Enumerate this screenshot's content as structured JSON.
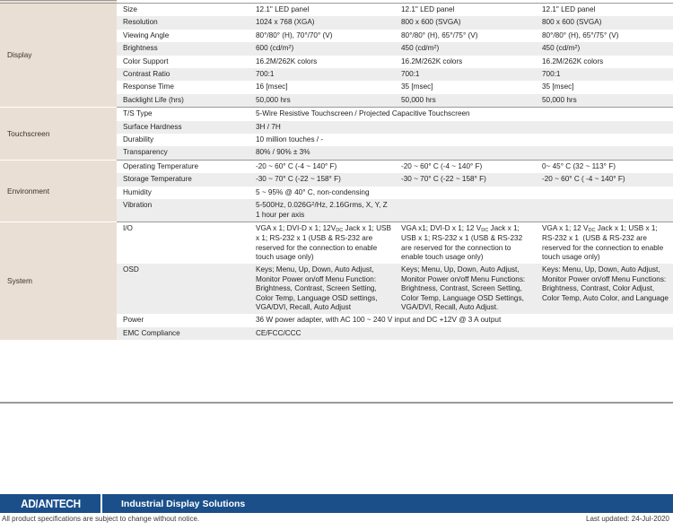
{
  "document": {
    "type": "product-specification-table"
  },
  "table": {
    "sections": [
      {
        "category": "",
        "clipped": true,
        "rows": [
          {
            "attr": "",
            "values": [
              "",
              "",
              ""
            ]
          }
        ]
      },
      {
        "category": "Display",
        "rows": [
          {
            "attr": "Size",
            "values": [
              "12.1\" LED panel",
              "12.1\" LED panel",
              "12.1\" LED panel"
            ]
          },
          {
            "attr": "Resolution",
            "values": [
              "1024 x 768 (XGA)",
              "800 x 600 (SVGA)",
              "800 x 600 (SVGA)"
            ]
          },
          {
            "attr": "Viewing Angle",
            "values": [
              "80°/80° (H), 70°/70° (V)",
              "80°/80° (H), 65°/75° (V)",
              "80°/80° (H), 65°/75° (V)"
            ]
          },
          {
            "attr": "Brightness",
            "values": [
              "600 (cd/m<sup>2</sup>)",
              "450 (cd/m<sup>2</sup>)",
              "450 (cd/m<sup>2</sup>)"
            ],
            "html": true
          },
          {
            "attr": "Color Support",
            "values": [
              "16.2M/262K colors",
              "16.2M/262K colors",
              "16.2M/262K colors"
            ]
          },
          {
            "attr": "Contrast Ratio",
            "values": [
              "700:1",
              "700:1",
              "700:1"
            ]
          },
          {
            "attr": "Response Time",
            "values": [
              "16 [msec]",
              "35 [msec]",
              "35 [msec]"
            ]
          },
          {
            "attr": "Backlight Life (hrs)",
            "values": [
              "50,000 hrs",
              "50,000 hrs",
              "50,000 hrs"
            ]
          }
        ]
      },
      {
        "category": "Touchscreen",
        "rows": [
          {
            "attr": "T/S Type",
            "span": "5-Wire Resistive Touchscreen / Projected Capacitive Touchscreen"
          },
          {
            "attr": "Surface Hardness",
            "span": "3H / 7H"
          },
          {
            "attr": "Durability",
            "span": "10 million touches / -"
          },
          {
            "attr": "Transparency",
            "span": "80% / 90% ± 3%"
          }
        ]
      },
      {
        "category": "Environment",
        "rows": [
          {
            "attr": "Operating Temperature",
            "values": [
              "-20 ~ 60° C (-4 ~ 140° F)",
              "-20 ~ 60° C (-4 ~ 140° F)",
              "0~ 45° C (32 ~ 113° F)"
            ]
          },
          {
            "attr": "Storage Temperature",
            "values": [
              "-30 ~ 70° C (-22 ~ 158° F)",
              "-30 ~ 70° C (-22 ~ 158° F)",
              "-20 ~ 60° C ( -4 ~ 140° F)"
            ]
          },
          {
            "attr": "Humidity",
            "span": "5 ~ 95% @ 40° C, non-condensing"
          },
          {
            "attr": "Vibration",
            "span": "5-500Hz, 0.026G<sup>2</sup>/Hz, 2.16Grms, X, Y, Z<br>1 hour per axis",
            "html": true
          }
        ]
      },
      {
        "category": "System",
        "rows": [
          {
            "attr": "I/O",
            "values": [
              "VGA x 1; DVI-D x 1; 12V<sub>DC</sub> Jack x 1; USB x 1; RS-232 x 1 (USB &amp; RS-232 are reserved for the connection to enable touch usage only)",
              "VGA x1; DVI-D x 1; 12 V<sub>DC</sub> Jack x 1; USB x 1; RS-232 x 1 (USB &amp; RS-232 are reserved for the connection to enable touch usage only)",
              "VGA x 1; 12 V<sub>DC</sub> Jack x 1; USB x 1; RS-232 x 1&nbsp; (USB &amp; RS-232 are reserved for the connection to enable&nbsp; touch usage only)"
            ],
            "html": true
          },
          {
            "attr": "OSD",
            "values": [
              "Keys; Menu, Up, Down, Auto Adjust, Monitor Power on/off Menu Function: Brightness, Contrast, Screen Setting, Color Temp, Language OSD settings, VGA/DVI, Recall, Auto Adjust",
              "Keys; Menu, Up, Down, Auto Adjust, Monitor Power on/off Menu Functions: Brightness, Contrast, Screen Setting, Color Temp, Language OSD Settings, VGA/DVI, Recall, Auto Adjust.",
              "Keys: Menu, Up, Down, Auto Adjust, Monitor Power on/off Menu Functions: Brightness, Contrast, Color Adjust,&nbsp; Color Temp, Auto Color, and Language"
            ],
            "html": true
          },
          {
            "attr": "Power",
            "span": "36 W power adapter, with AC 100 ~ 240 V input and DC +12V @ 3 A output"
          },
          {
            "attr": "EMC Compliance",
            "span": "CE/FCC/CCC"
          }
        ]
      }
    ]
  },
  "footer": {
    "brand_part1": "AD",
    "brand_slash": "\\",
    "brand_part2": "ANTECH",
    "tagline": "Industrial Display Solutions",
    "disclaimer": "All product specifications are subject to change without notice.",
    "last_updated": "Last updated: 24-Jul-2020",
    "banner_color": "#1b4f8a"
  }
}
